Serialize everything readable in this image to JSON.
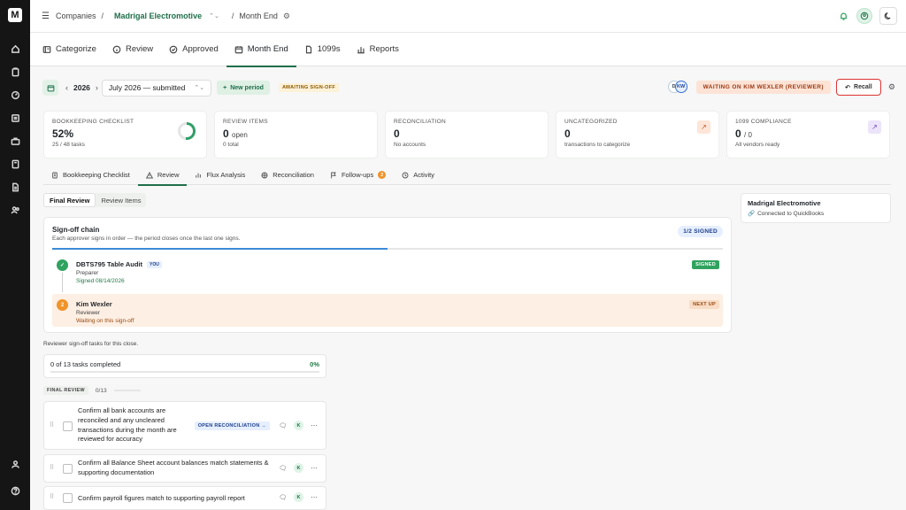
{
  "sidebar": {
    "logo": "M",
    "items": [
      {
        "icon": "home-icon"
      },
      {
        "icon": "clipboard-icon"
      },
      {
        "icon": "gauge-icon"
      },
      {
        "icon": "ledger-icon"
      },
      {
        "icon": "briefcase-icon"
      },
      {
        "icon": "book-icon"
      },
      {
        "icon": "document-icon"
      },
      {
        "icon": "users-icon"
      }
    ],
    "bottom": [
      {
        "icon": "user-icon"
      },
      {
        "icon": "help-icon"
      }
    ]
  },
  "topbar": {
    "crumb_root": "Companies",
    "company": "Madrigal Electromotive",
    "page": "Month End",
    "sep": "/"
  },
  "main_tabs": [
    {
      "label": "Categorize",
      "icon": "categorize-icon"
    },
    {
      "label": "Review",
      "icon": "info-icon"
    },
    {
      "label": "Approved",
      "icon": "check-circle-icon"
    },
    {
      "label": "Month End",
      "icon": "calendar-icon",
      "active": true
    },
    {
      "label": "1099s",
      "icon": "file-icon"
    },
    {
      "label": "Reports",
      "icon": "bar-chart-icon"
    }
  ],
  "period": {
    "year": "2026",
    "selected": "July 2026 — submitted",
    "new_period": "New period",
    "status": "AWAITING SIGN-OFF",
    "avatars": [
      "D",
      "KW"
    ],
    "waiting": "WAITING ON KIM WEXLER (REVIEWER)",
    "recall": "Recall"
  },
  "stats": {
    "checklist": {
      "label": "BOOKKEEPING CHECKLIST",
      "value": "52%",
      "sub": "25 / 48 tasks",
      "progress": 0.52
    },
    "review": {
      "label": "REVIEW ITEMS",
      "value": "0",
      "unit": "open",
      "sub": "0 total"
    },
    "reconciliation": {
      "label": "RECONCILIATION",
      "value": "0",
      "sub": "No accounts"
    },
    "uncategorized": {
      "label": "UNCATEGORIZED",
      "value": "0",
      "sub": "transactions to categorize"
    },
    "compliance": {
      "label": "1099 COMPLIANCE",
      "value": "0",
      "unit": "/ 0",
      "sub": "All vendors ready"
    }
  },
  "sub_tabs": [
    {
      "label": "Bookkeeping Checklist",
      "icon": "checklist-icon"
    },
    {
      "label": "Review",
      "icon": "warning-icon",
      "active": true
    },
    {
      "label": "Flux Analysis",
      "icon": "bar-chart-icon"
    },
    {
      "label": "Reconciliation",
      "icon": "scale-icon"
    },
    {
      "label": "Follow-ups",
      "icon": "flag-icon",
      "badge": "2"
    },
    {
      "label": "Activity",
      "icon": "history-icon"
    }
  ],
  "segmented": {
    "final": "Final Review",
    "items": "Review Items"
  },
  "signoff": {
    "title": "Sign-off chain",
    "desc": "Each approver signs in order — the period closes once the last one signs.",
    "count": "1/2 SIGNED",
    "signers": [
      {
        "step": "✓",
        "name": "DBTS795 Table Audit",
        "tag": "YOU",
        "role": "Preparer",
        "status": "Signed 08/14/2026",
        "badge": "SIGNED"
      },
      {
        "step": "2",
        "name": "Kim Wexler",
        "role": "Reviewer",
        "status": "Waiting on this sign-off",
        "badge": "NEXT UP"
      }
    ]
  },
  "qb": {
    "title": "Madrigal Electromotive",
    "sub": "Connected to QuickBooks"
  },
  "tasks": {
    "intro": "Reviewer sign-off tasks for this close.",
    "progress": "0 of 13 tasks completed",
    "pct": "0%",
    "section": "FINAL REVIEW",
    "section_count": "0/13",
    "items": [
      {
        "text": "Confirm all bank accounts are reconciled and any uncleared transactions during the month are reviewed for accuracy",
        "action": "OPEN RECONCILIATION →",
        "assignee": "K"
      },
      {
        "text": "Confirm all Balance Sheet account balances match statements & supporting documentation",
        "assignee": "K"
      },
      {
        "text": "Confirm payroll figures match to supporting payroll report",
        "assignee": "K"
      }
    ]
  }
}
